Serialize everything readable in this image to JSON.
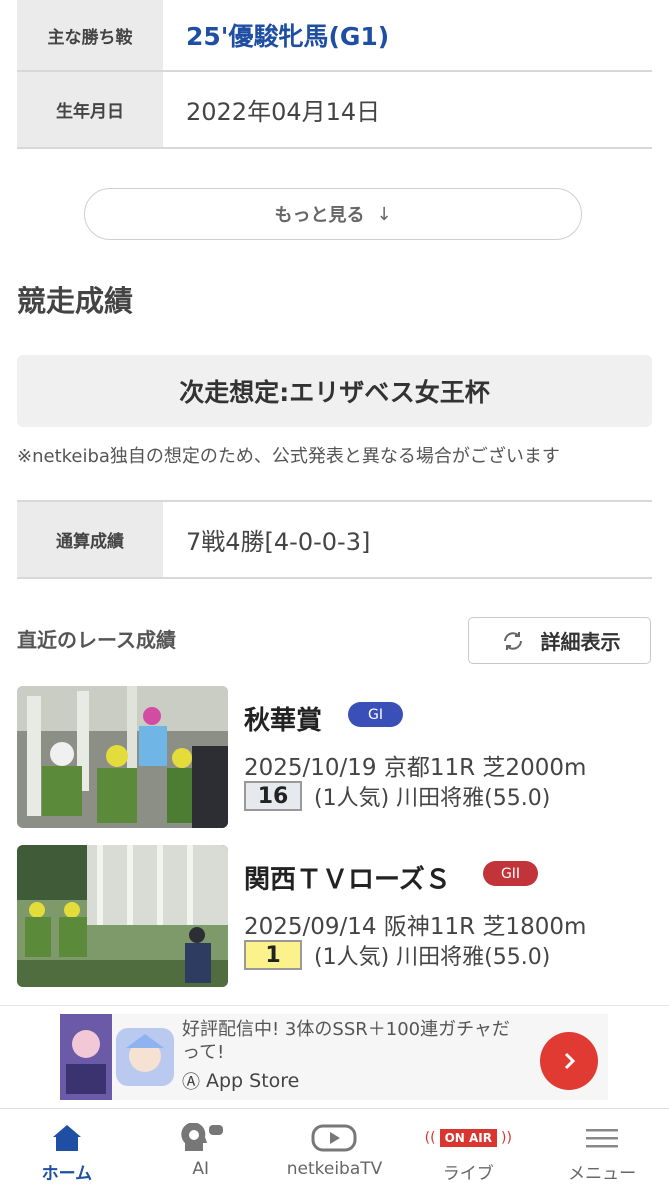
{
  "profile": {
    "main_win_label": "主な勝ち鞍",
    "main_win_value": "25'優駿牝馬(G1)",
    "birth_label": "生年月日",
    "birth_value": "2022年04月14日",
    "more_label": "もっと見る",
    "more_arrow": "↓"
  },
  "results": {
    "section_title": "競走成績",
    "next_race": "次走想定:エリザベス女王杯",
    "note": "※netkeiba独自の想定のため、公式発表と異なる場合がございます",
    "total_label": "通算成績",
    "total_value": "7戦4勝[4-0-0-3]",
    "recent_label": "直近のレース成績",
    "detail_button": "詳細表示"
  },
  "races": [
    {
      "name": "秋華賞",
      "grade": "GI",
      "grade_color": "#3b4fb8",
      "meta": "2025/10/19 京都11R 芝2000m",
      "position": "16",
      "position_bg": "#e6e9ee",
      "detail": "(1人気) 川田将雅(55.0)"
    },
    {
      "name": "関西ＴＶローズＳ",
      "grade": "GII",
      "grade_color": "#c0343a",
      "meta": "2025/09/14 阪神11R 芝1800m",
      "position": "1",
      "position_bg": "#fbf28c",
      "detail": "(1人気) 川田将雅(55.0)"
    }
  ],
  "ad": {
    "text": "好評配信中! 3体のSSR＋100連ガチャだって!",
    "store": "App Store"
  },
  "tabs": [
    {
      "label": "ホーム",
      "icon": "home-icon"
    },
    {
      "label": "AI",
      "icon": "ai-icon"
    },
    {
      "label": "netkeibaTV",
      "icon": "tv-icon"
    },
    {
      "label": "ライブ",
      "icon": "on-air-icon",
      "badge": "ON AIR"
    },
    {
      "label": "メニュー",
      "icon": "menu-icon"
    }
  ],
  "colors": {
    "accent": "#1f4fa3",
    "ad_button": "#e03a32",
    "on_air": "#d9362f"
  }
}
